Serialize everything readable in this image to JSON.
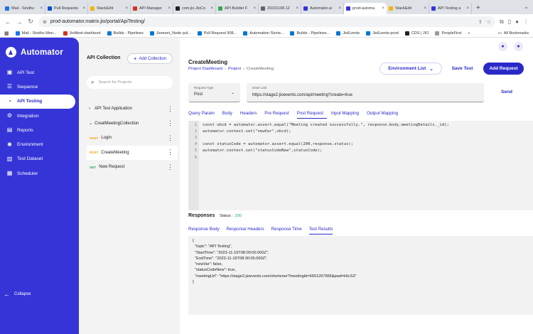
{
  "browser": {
    "tabs": [
      {
        "label": "Mail - Sindhu",
        "color": "#1a73e8",
        "active": false
      },
      {
        "label": "Pull Requests",
        "color": "#0052cc",
        "active": false
      },
      {
        "label": "StackEdit",
        "color": "#f4b400",
        "active": false
      },
      {
        "label": "API Manager",
        "color": "#d93025",
        "active": false
      },
      {
        "label": "com.jio.JioCo",
        "color": "#202124",
        "active": false
      },
      {
        "label": "API Builder F",
        "color": "#34a853",
        "active": false
      },
      {
        "label": "20231108.12",
        "color": "#5f6368",
        "active": false
      },
      {
        "label": "Automator.ai",
        "color": "#3535d7",
        "active": false
      },
      {
        "label": "prod-automa",
        "color": "#3535d7",
        "active": true
      },
      {
        "label": "StackEdit",
        "color": "#f4b400",
        "active": false
      },
      {
        "label": "API Testing a",
        "color": "#3535d7",
        "active": false
      }
    ],
    "new_tab": "+",
    "url": "prod-automator.matrix.jio/portal/ApiTesting/",
    "bookmarks": [
      {
        "label": "Mail - Sindhu Men...",
        "color": "#1a73e8"
      },
      {
        "label": "JioMeet-dashbord",
        "color": "#d93025"
      },
      {
        "label": "Builds - Pipelines",
        "color": "#0078d4"
      },
      {
        "label": "Jiomeet_Node pul...",
        "color": "#0078d4"
      },
      {
        "label": "Pull Request 908...",
        "color": "#0078d4"
      },
      {
        "label": "Automation Storie...",
        "color": "#0078d4"
      },
      {
        "label": "Builds - Pipelines...",
        "color": "#0078d4"
      },
      {
        "label": "JioEvents",
        "color": "#0078d4"
      },
      {
        "label": "JioEvents-prod",
        "color": "#0078d4"
      },
      {
        "label": "CDS | JIO",
        "color": "#222222"
      },
      {
        "label": "PeopleFirst",
        "color": "#999999"
      }
    ],
    "all_bookmarks": "All Bookmarks"
  },
  "sidebar": {
    "brand": "Automator",
    "items": [
      {
        "label": "API Test",
        "icon": "api-test-icon",
        "glyph": "▣",
        "active": false
      },
      {
        "label": "Sequence",
        "icon": "sequence-icon",
        "glyph": "☰",
        "active": false
      },
      {
        "label": "API Testing",
        "icon": "api-testing-icon",
        "glyph": "◔",
        "active": true
      },
      {
        "label": "Integration",
        "icon": "integration-icon",
        "glyph": "⚙",
        "active": false
      },
      {
        "label": "Reports",
        "icon": "reports-icon",
        "glyph": "▤",
        "active": false
      },
      {
        "label": "Environment",
        "icon": "environment-icon",
        "glyph": "✺",
        "active": false
      },
      {
        "label": "Test Dataset",
        "icon": "dataset-icon",
        "glyph": "▥",
        "active": false
      },
      {
        "label": "Scheduler",
        "icon": "scheduler-icon",
        "glyph": "▦",
        "active": false
      }
    ],
    "collapse": "Collapse"
  },
  "collections": {
    "title": "API Collection",
    "add_label": "Add Collection",
    "search_placeholder": "Search for Projects",
    "tree": [
      {
        "type": "folder",
        "label": "API Test Application",
        "chevron": "›",
        "indent": 0
      },
      {
        "type": "folder",
        "label": "CreatMeetingCollection",
        "chevron": "⌄",
        "indent": 0
      },
      {
        "type": "request",
        "method": "POST",
        "label": "Login",
        "selected": false
      },
      {
        "type": "request",
        "method": "POST",
        "label": "CreateMeeting",
        "selected": true
      },
      {
        "type": "request",
        "method": "GET",
        "label": "New Request",
        "selected": false
      }
    ]
  },
  "main": {
    "title": "CreateMeeting",
    "breadcrumbs": [
      "Project Dashboard",
      "Project",
      "CreateMeeting"
    ],
    "env_button": "Environment List",
    "save_button": "Save Test",
    "add_request_button": "Add Request",
    "request_type_label": "Request Type",
    "request_type_value": "Post",
    "link_label": "Enter Link",
    "link_value": "https://stage2.jioevents.com/api/meeting?create=true",
    "send_button": "Send",
    "tabs": [
      "Query Param",
      "Body",
      "Headers",
      "Pre Request",
      "Post Request",
      "Input Mapping",
      "Output Mapping"
    ],
    "active_tab": "Post Request",
    "code_lines": [
      "const obcd = automator.assert.equal(\"Meeting created successfully.\", response.body.meetingDetails._id);",
      "automator.context.set(\"newVar\",obcd);",
      "",
      "const statusCode = automator.assert.equal(200,response.status);",
      "automator.context.set(\"statusCodeNew\",statusCode);",
      ""
    ],
    "responses_title": "Responses",
    "status_label": "Status :",
    "status_value": "200",
    "response_tabs": [
      "Response Body",
      "Response Headers",
      "Response Time",
      "Test Results"
    ],
    "active_response_tab": "Test Results",
    "result_lines": [
      "{",
      "  \"topic\": \"API Testing\",",
      "  \"StartTime\": \"2023-11-19T08:00:00.000Z\",",
      "  \"EndTime\": \"2023-11-19T08:30:00.000Z\",",
      "  \"newVar\": false,",
      "  \"statusCodeNew\": true,",
      "  \"meetingUrl\": \"https://stage2.jioevents.com/shortener?meetingId=6651267965&pwd=k6cS3\"",
      "}"
    ]
  }
}
